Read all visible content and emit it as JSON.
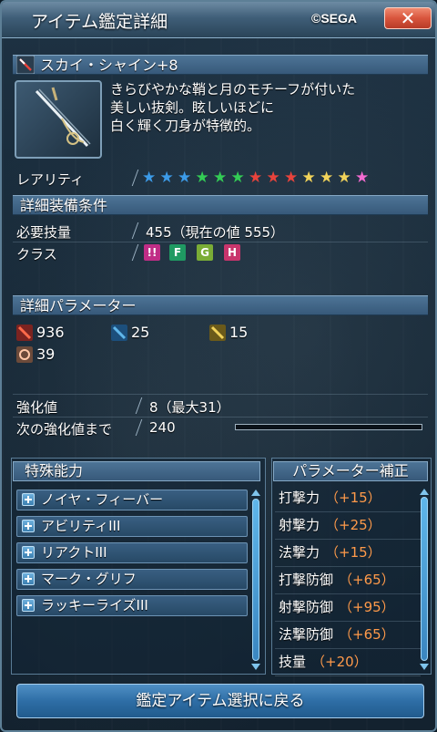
{
  "window": {
    "title": "アイテム鑑定詳細",
    "copyright": "©SEGA",
    "close_label": "✕"
  },
  "item": {
    "name": "スカイ・シャイン+8",
    "icon": "sword-icon",
    "description": [
      "きらびやかな鞘と月のモチーフが付いた",
      "美しい抜剣。眩しいほどに",
      "白く輝く刀身が特徴的。"
    ]
  },
  "rarity": {
    "label": "レアリティ",
    "stars": 13,
    "star_colors": [
      "#3c9be8",
      "#3c9be8",
      "#3c9be8",
      "#33cc55",
      "#33cc55",
      "#33cc55",
      "#e8433c",
      "#e8433c",
      "#e8433c",
      "#f2d35a",
      "#f2d35a",
      "#f2d35a",
      "#f26bd0"
    ]
  },
  "requirements": {
    "header": "詳細装備条件",
    "skill_label": "必要技量",
    "skill_value": "455（現在の値 555）",
    "class_label": "クラス",
    "classes": [
      {
        "icon": "hunter-class-icon",
        "color": "#e040a0",
        "glyph": "!!"
      },
      {
        "icon": "fighter-class-icon",
        "color": "#25b070",
        "glyph": "F"
      },
      {
        "icon": "gunner-class-icon",
        "color": "#8cc63f",
        "glyph": "G"
      },
      {
        "icon": "braver-class-icon",
        "color": "#e0407a",
        "glyph": "H"
      }
    ]
  },
  "params": {
    "header": "詳細パラメーター",
    "attack_melee": "936",
    "attack_ranged": "25",
    "attack_tech": "15",
    "dexterity": "39"
  },
  "enhance": {
    "level_label": "強化値",
    "level_value": "8（最大31）",
    "next_label": "次の強化値まで",
    "next_value": "240",
    "progress": 0
  },
  "abilities": {
    "header": "特殊能力",
    "items": [
      "ノイヤ・フィーバー",
      "アビリティIII",
      "リアクトIII",
      "マーク・グリフ",
      "ラッキーライズIII"
    ]
  },
  "param_bonus": {
    "header": "パラメーター補正",
    "items": [
      {
        "name": "打撃力",
        "value": "（+15）"
      },
      {
        "name": "射撃力",
        "value": "（+25）"
      },
      {
        "name": "法撃力",
        "value": "（+15）"
      },
      {
        "name": "打撃防御",
        "value": "（+65）"
      },
      {
        "name": "射撃防御",
        "value": "（+95）"
      },
      {
        "name": "法撃防御",
        "value": "（+65）"
      },
      {
        "name": "技量",
        "value": "（+20）"
      }
    ]
  },
  "footer": {
    "back_button": "鑑定アイテム選択に戻る"
  },
  "colors": {
    "accent": "#3c9be8",
    "bonus_value": "#ff9a4a",
    "close": "#d8553d"
  }
}
